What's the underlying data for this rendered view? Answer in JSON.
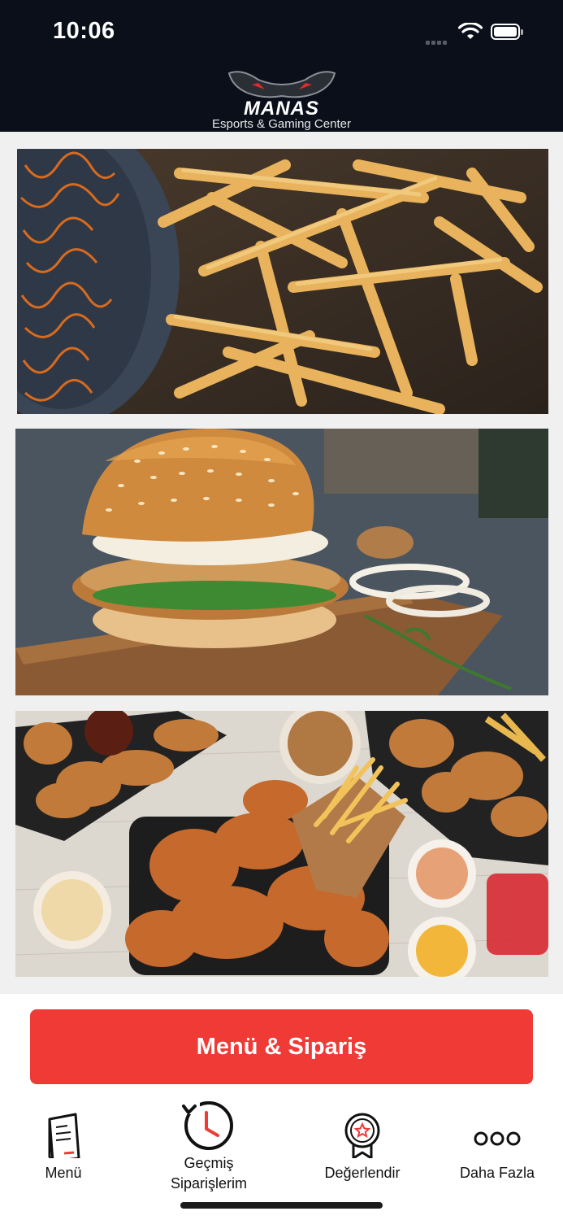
{
  "status_bar": {
    "time": "10:06"
  },
  "header": {
    "brand_name": "MANAS",
    "brand_tagline": "Esports & Gaming Center"
  },
  "images": [
    {
      "subject": "french-fries"
    },
    {
      "subject": "crispy-chicken-burger"
    },
    {
      "subject": "fried-chicken-platter"
    }
  ],
  "order_button": {
    "label": "Menü & Sipariş",
    "color": "#ef3a36"
  },
  "tabs": [
    {
      "label": "Menü",
      "icon": "menu-book-icon"
    },
    {
      "label": "Geçmiş Siparişlerim",
      "icon": "history-clock-icon"
    },
    {
      "label": "Değerlendir",
      "icon": "rating-badge-icon"
    },
    {
      "label": "Daha Fazla",
      "icon": "more-dots-icon"
    }
  ],
  "accent_color": "#ef3a36"
}
